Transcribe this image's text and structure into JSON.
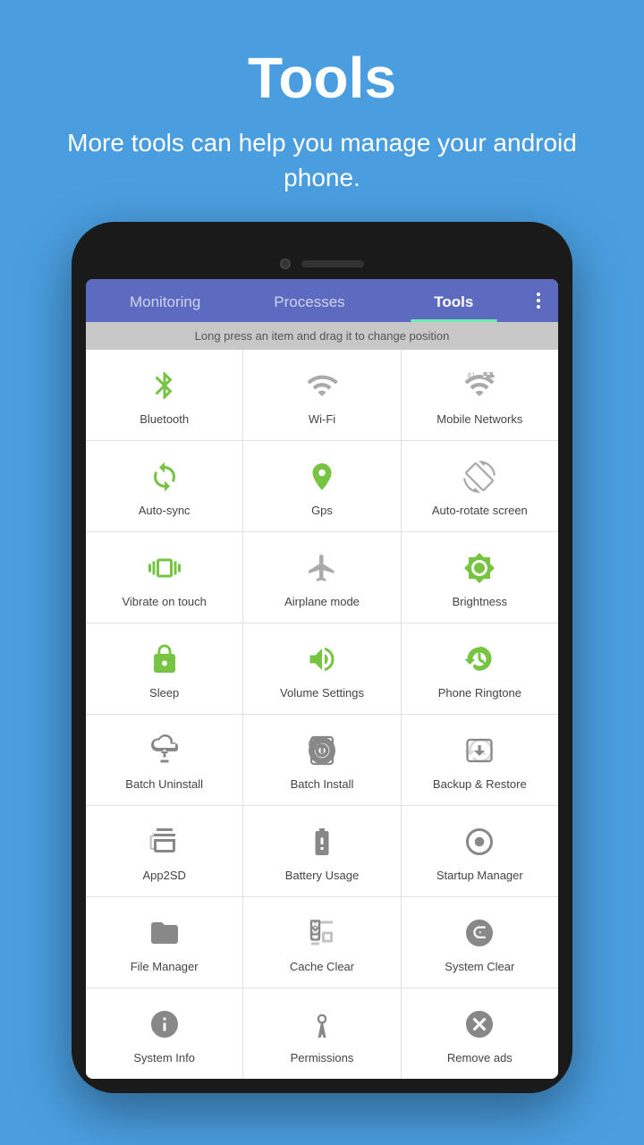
{
  "header": {
    "title": "Tools",
    "subtitle": "More tools can help you manage your android phone."
  },
  "tabs": [
    {
      "id": "monitoring",
      "label": "Monitoring",
      "active": false
    },
    {
      "id": "processes",
      "label": "Processes",
      "active": false
    },
    {
      "id": "tools",
      "label": "Tools",
      "active": true
    }
  ],
  "hint": "Long press an item and drag it to change position",
  "more_button": "⋮",
  "grid_items": [
    {
      "id": "bluetooth",
      "label": "Bluetooth",
      "color": "green",
      "icon": "bluetooth"
    },
    {
      "id": "wifi",
      "label": "Wi-Fi",
      "color": "gray",
      "icon": "wifi"
    },
    {
      "id": "mobile-networks",
      "label": "Mobile Networks",
      "color": "gray",
      "icon": "mobile-networks"
    },
    {
      "id": "auto-sync",
      "label": "Auto-sync",
      "color": "green",
      "icon": "auto-sync"
    },
    {
      "id": "gps",
      "label": "Gps",
      "color": "green",
      "icon": "gps"
    },
    {
      "id": "auto-rotate",
      "label": "Auto-rotate screen",
      "color": "gray",
      "icon": "auto-rotate"
    },
    {
      "id": "vibrate",
      "label": "Vibrate on touch",
      "color": "green",
      "icon": "vibrate"
    },
    {
      "id": "airplane",
      "label": "Airplane mode",
      "color": "gray",
      "icon": "airplane"
    },
    {
      "id": "brightness",
      "label": "Brightness",
      "color": "green",
      "icon": "brightness"
    },
    {
      "id": "sleep",
      "label": "Sleep",
      "color": "green",
      "icon": "sleep"
    },
    {
      "id": "volume",
      "label": "Volume Settings",
      "color": "green",
      "icon": "volume"
    },
    {
      "id": "ringtone",
      "label": "Phone Ringtone",
      "color": "green",
      "icon": "ringtone"
    },
    {
      "id": "batch-uninstall",
      "label": "Batch Uninstall",
      "color": "gray",
      "icon": "batch-uninstall"
    },
    {
      "id": "batch-install",
      "label": "Batch Install",
      "color": "gray",
      "icon": "batch-install"
    },
    {
      "id": "backup",
      "label": "Backup & Restore",
      "color": "gray",
      "icon": "backup"
    },
    {
      "id": "app2sd",
      "label": "App2SD",
      "color": "gray",
      "icon": "app2sd"
    },
    {
      "id": "battery",
      "label": "Battery Usage",
      "color": "gray",
      "icon": "battery"
    },
    {
      "id": "startup",
      "label": "Startup Manager",
      "color": "gray",
      "icon": "startup"
    },
    {
      "id": "file-manager",
      "label": "File Manager",
      "color": "gray",
      "icon": "file-manager"
    },
    {
      "id": "cache-clear",
      "label": "Cache Clear",
      "color": "gray",
      "icon": "cache-clear"
    },
    {
      "id": "system-clear",
      "label": "System Clear",
      "color": "gray",
      "icon": "system-clear"
    },
    {
      "id": "system-info",
      "label": "System Info",
      "color": "gray",
      "icon": "system-info"
    },
    {
      "id": "permissions",
      "label": "Permissions",
      "color": "gray",
      "icon": "permissions"
    },
    {
      "id": "remove-ads",
      "label": "Remove ads",
      "color": "gray",
      "icon": "remove-ads"
    }
  ]
}
